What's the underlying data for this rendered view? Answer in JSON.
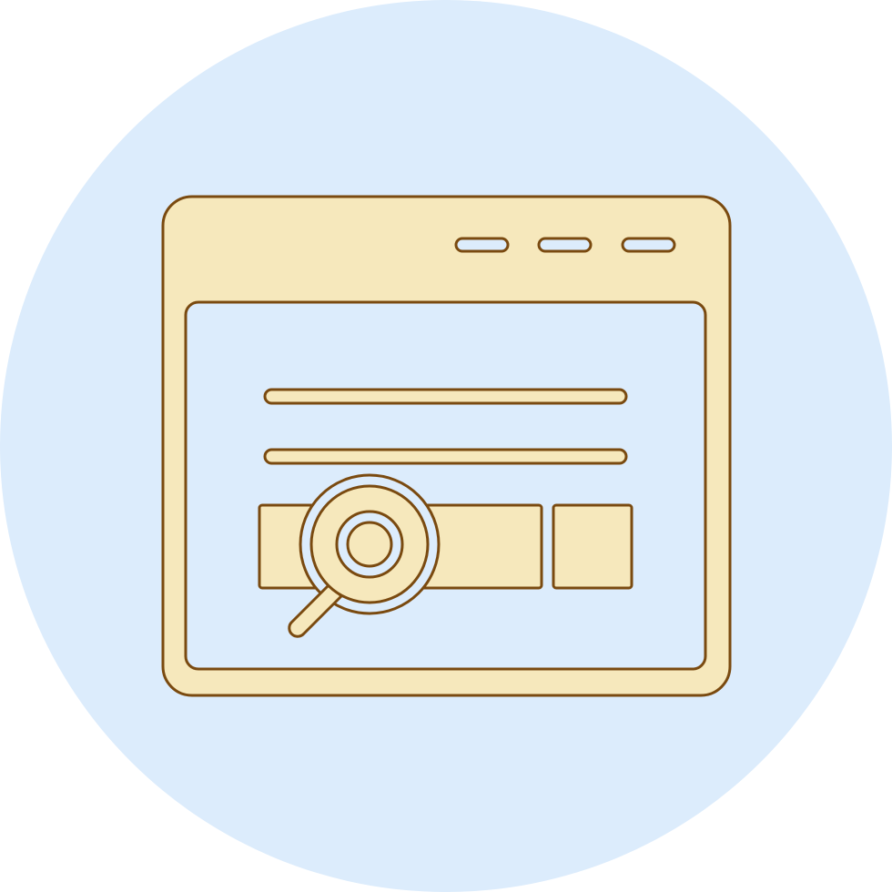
{
  "icon": {
    "name": "web-search-icon",
    "window_controls_count": 3,
    "text_lines_count": 2
  },
  "colors": {
    "background_circle": "#dcecfc",
    "fill": "#f6e8bc",
    "stroke": "#7a4a10",
    "page_background": "#ffffff"
  }
}
